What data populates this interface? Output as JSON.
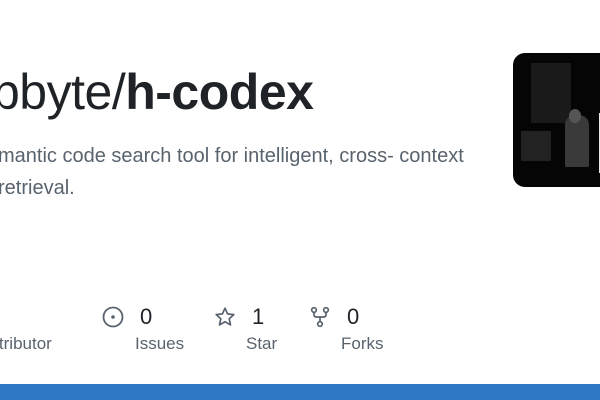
{
  "repo": {
    "owner_fragment": "bbyte",
    "separator": "/",
    "name": "h-codex",
    "description": "mantic code search tool for intelligent, cross- context retrieval."
  },
  "avatar": {
    "icon": "owner-avatar-dark-photo"
  },
  "stats": [
    {
      "key": "contributors",
      "count": "",
      "label": "ontributor",
      "icon": "people-icon"
    },
    {
      "key": "issues",
      "count": "0",
      "label": "Issues",
      "icon": "issue-opened-icon"
    },
    {
      "key": "stars",
      "count": "1",
      "label": "Star",
      "icon": "star-icon"
    },
    {
      "key": "forks",
      "count": "0",
      "label": "Forks",
      "icon": "repo-forked-icon"
    }
  ],
  "colors": {
    "title": "#1f2328",
    "muted": "#59636e",
    "language_bar": "#3178c6"
  }
}
